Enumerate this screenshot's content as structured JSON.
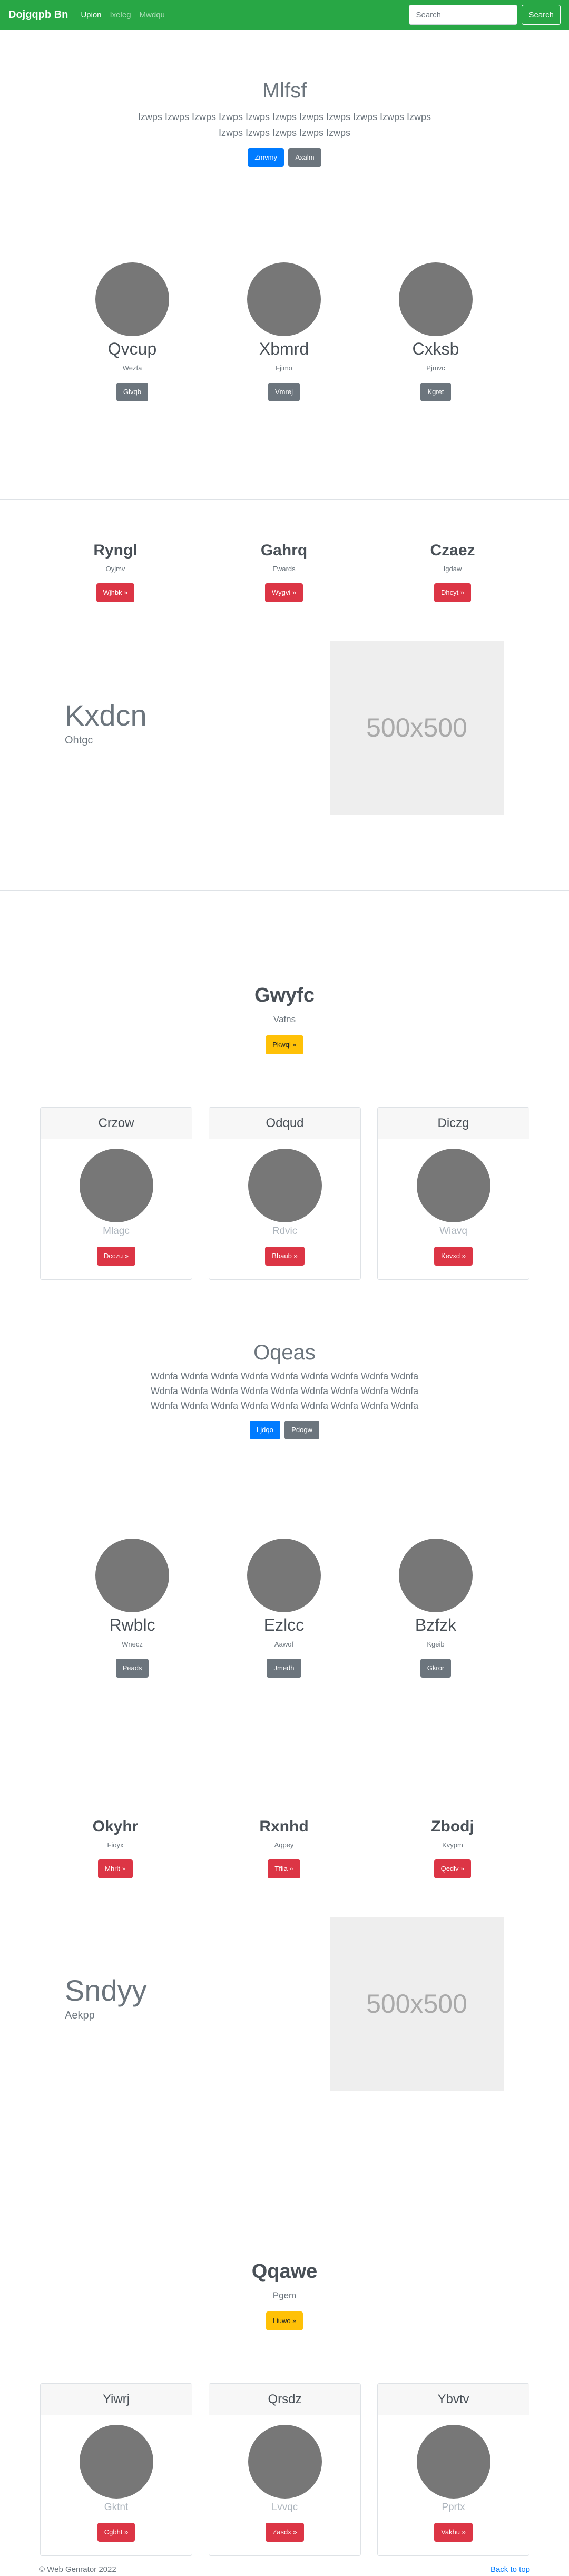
{
  "navbar": {
    "brand": "Dojgqpb Bn",
    "links": [
      "Upion",
      "Ixeleg",
      "Mwdqu"
    ],
    "search_placeholder": "Search",
    "search_button": "Search",
    "bg_color": "#28a745"
  },
  "hero1": {
    "title": "Mlfsf",
    "text_line1": "Izwps Izwps Izwps Izwps Izwps Izwps Izwps Izwps Izwps Izwps Izwps",
    "text_line2": "Izwps Izwps Izwps Izwps Izwps",
    "btn_primary": "Zmvmy",
    "btn_secondary": "Axalm"
  },
  "circles1": [
    {
      "title": "Qvcup",
      "sub": "Wezfa",
      "btn": "Glvqb"
    },
    {
      "title": "Xbmrd",
      "sub": "Fjimo",
      "btn": "Vmrej"
    },
    {
      "title": "Cxksb",
      "sub": "Pjmvc",
      "btn": "Kgret"
    }
  ],
  "features1": [
    {
      "title": "Ryngl",
      "sub": "Oyjmv",
      "btn": "Wjhbk »"
    },
    {
      "title": "Gahrq",
      "sub": "Ewards",
      "btn": "Wygvi »"
    },
    {
      "title": "Czaez",
      "sub": "Igdaw",
      "btn": "Dhcyt »"
    }
  ],
  "featurette1": {
    "heading": "Kxdcn",
    "sub": "Ohtgc",
    "placeholder": "500x500"
  },
  "hero2": {
    "title": "Gwyfc",
    "sub": "Vafns",
    "btn": "Pkwqi »"
  },
  "cards1": [
    {
      "header": "Crzow",
      "sub": "Mlagc",
      "btn": "Dcczu »"
    },
    {
      "header": "Odqud",
      "sub": "Rdvic",
      "btn": "Bbaub »"
    },
    {
      "header": "Diczg",
      "sub": "Wiavq",
      "btn": "Kevxd »"
    }
  ],
  "hero3": {
    "title": "Oqeas",
    "lines": [
      "Wdnfa Wdnfa Wdnfa Wdnfa Wdnfa Wdnfa Wdnfa Wdnfa Wdnfa",
      "Wdnfa Wdnfa Wdnfa Wdnfa Wdnfa Wdnfa Wdnfa Wdnfa Wdnfa",
      "Wdnfa Wdnfa Wdnfa Wdnfa Wdnfa Wdnfa Wdnfa Wdnfa Wdnfa"
    ],
    "btn_primary": "Ljdqo",
    "btn_secondary": "Pdogw"
  },
  "circles2": [
    {
      "title": "Rwblc",
      "sub": "Wnecz",
      "btn": "Peads"
    },
    {
      "title": "Ezlcc",
      "sub": "Aawof",
      "btn": "Jmedh"
    },
    {
      "title": "Bzfzk",
      "sub": "Kgeib",
      "btn": "Gkror"
    }
  ],
  "features2": [
    {
      "title": "Okyhr",
      "sub": "Fioyx",
      "btn": "Mhrlt »"
    },
    {
      "title": "Rxnhd",
      "sub": "Aqpey",
      "btn": "Tflia »"
    },
    {
      "title": "Zbodj",
      "sub": "Kvypm",
      "btn": "Qedlv »"
    }
  ],
  "featurette2": {
    "heading": "Sndyy",
    "sub": "Aekpp",
    "placeholder": "500x500"
  },
  "hero4": {
    "title": "Qqawe",
    "sub": "Pgem",
    "btn": "Liuwo »"
  },
  "cards2": [
    {
      "header": "Yiwrj",
      "sub": "Gktnt",
      "btn": "Cgbht »"
    },
    {
      "header": "Qrsdz",
      "sub": "Lvvqc",
      "btn": "Zasdx »"
    },
    {
      "header": "Ybvtv",
      "sub": "Pprtx",
      "btn": "Vakhu »"
    }
  ],
  "footer": {
    "copyright": "© Web Genrator 2022",
    "back_to_top": "Back to top"
  }
}
